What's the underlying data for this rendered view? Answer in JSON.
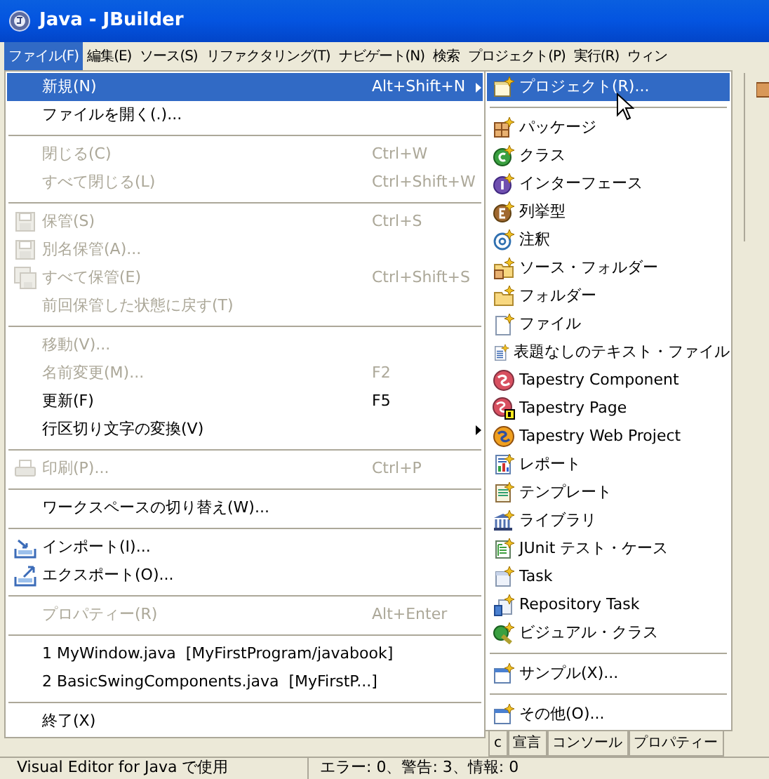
{
  "window": {
    "title": "Java - JBuilder"
  },
  "menu_bar": [
    {
      "label": "ファイル(F)",
      "selected": true
    },
    {
      "label": "編集(E)",
      "selected": false
    },
    {
      "label": "ソース(S)",
      "selected": false
    },
    {
      "label": "リファクタリング(T)",
      "selected": false
    },
    {
      "label": "ナビゲート(N)",
      "selected": false
    },
    {
      "label": "検索",
      "selected": false
    },
    {
      "label": "プロジェクト(P)",
      "selected": false
    },
    {
      "label": "実行(R)",
      "selected": false
    },
    {
      "label": "ウィン",
      "selected": false
    }
  ],
  "file_menu": {
    "groups": [
      [
        {
          "label": "新規(N)",
          "shortcut": "Alt+Shift+N",
          "submenu": true,
          "disabled": false,
          "selected": true
        },
        {
          "label": "ファイルを開く(.)...",
          "submenu": false,
          "disabled": false,
          "selected": false
        }
      ],
      [
        {
          "label": "閉じる(C)",
          "shortcut": "Ctrl+W",
          "submenu": false,
          "disabled": true,
          "selected": false
        },
        {
          "label": "すべて閉じる(L)",
          "shortcut": "Ctrl+Shift+W",
          "submenu": false,
          "disabled": true,
          "selected": false
        }
      ],
      [
        {
          "label": "保管(S)",
          "shortcut": "Ctrl+S",
          "submenu": false,
          "disabled": true,
          "selected": false
        },
        {
          "label": "別名保管(A)...",
          "submenu": false,
          "disabled": true,
          "selected": false
        },
        {
          "label": "すべて保管(E)",
          "shortcut": "Ctrl+Shift+S",
          "submenu": false,
          "disabled": true,
          "selected": false
        },
        {
          "label": "前回保管した状態に戻す(T)",
          "submenu": false,
          "disabled": true,
          "selected": false
        }
      ],
      [
        {
          "label": "移動(V)...",
          "submenu": false,
          "disabled": true,
          "selected": false
        },
        {
          "label": "名前変更(M)...",
          "shortcut": "F2",
          "submenu": false,
          "disabled": true,
          "selected": false
        },
        {
          "label": "更新(F)",
          "shortcut": "F5",
          "submenu": false,
          "disabled": false,
          "selected": false
        },
        {
          "label": "行区切り文字の変換(V)",
          "submenu": true,
          "disabled": false,
          "selected": false
        }
      ],
      [
        {
          "label": "印刷(P)...",
          "shortcut": "Ctrl+P",
          "submenu": false,
          "disabled": true,
          "selected": false
        }
      ],
      [
        {
          "label": "ワークスペースの切り替え(W)...",
          "submenu": false,
          "disabled": false,
          "selected": false
        }
      ],
      [
        {
          "label": "インポート(I)...",
          "submenu": false,
          "disabled": false,
          "selected": false
        },
        {
          "label": "エクスポート(O)...",
          "submenu": false,
          "disabled": false,
          "selected": false
        }
      ],
      [
        {
          "label": "プロパティー(R)",
          "shortcut": "Alt+Enter",
          "submenu": false,
          "disabled": true,
          "selected": false
        }
      ],
      [
        {
          "label": "1 MyWindow.java  [MyFirstProgram/javabook]",
          "submenu": false,
          "disabled": false,
          "selected": false
        },
        {
          "label": "2 BasicSwingComponents.java  [MyFirstP...]",
          "submenu": false,
          "disabled": false,
          "selected": false
        }
      ],
      [
        {
          "label": "終了(X)",
          "submenu": false,
          "disabled": false,
          "selected": false
        }
      ]
    ]
  },
  "new_submenu": {
    "groups": [
      [
        {
          "label": "プロジェクト(R)...",
          "selected": true
        }
      ],
      [
        {
          "label": "パッケージ",
          "selected": false
        },
        {
          "label": "クラス",
          "selected": false
        },
        {
          "label": "インターフェース",
          "selected": false
        },
        {
          "label": "列挙型",
          "selected": false
        },
        {
          "label": "注釈",
          "selected": false
        },
        {
          "label": "ソース・フォルダー",
          "selected": false
        },
        {
          "label": "フォルダー",
          "selected": false
        },
        {
          "label": "ファイル",
          "selected": false
        },
        {
          "label": "表題なしのテキスト・ファイル",
          "selected": false
        },
        {
          "label": "Tapestry Component",
          "selected": false
        },
        {
          "label": "Tapestry Page",
          "selected": false
        },
        {
          "label": "Tapestry Web Project",
          "selected": false
        },
        {
          "label": "レポート",
          "selected": false
        },
        {
          "label": "テンプレート",
          "selected": false
        },
        {
          "label": "ライブラリ",
          "selected": false
        },
        {
          "label": "JUnit テスト・ケース",
          "selected": false
        },
        {
          "label": "Task",
          "selected": false
        },
        {
          "label": "Repository Task",
          "selected": false
        },
        {
          "label": "ビジュアル・クラス",
          "selected": false
        }
      ],
      [
        {
          "label": "サンプル(X)...",
          "selected": false
        }
      ],
      [
        {
          "label": "その他(O)...",
          "selected": false
        }
      ]
    ]
  },
  "bottom_tabs": [
    {
      "label": "c"
    },
    {
      "label": "宣言"
    },
    {
      "label": "コンソール"
    },
    {
      "label": "プロパティー"
    }
  ],
  "status_bar": {
    "left": "Visual Editor for Java で使用",
    "right": "エラー: 0、警告: 3、情報: 0"
  }
}
